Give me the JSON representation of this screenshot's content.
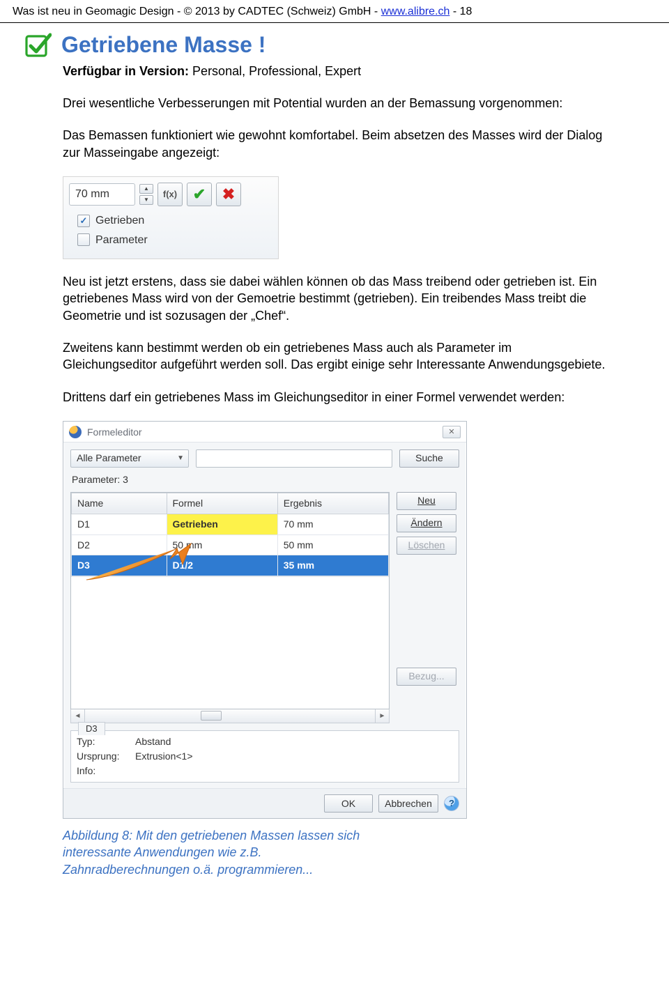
{
  "header": {
    "part1": "Was ist neu in Geomagic Design  -  © 2013 by CADTEC (Schweiz) GmbH  -  ",
    "link": "www.alibre.ch",
    "part2": "  -   18"
  },
  "title": "Getriebene Masse !",
  "avail_label": "Verfügbar in Version:",
  "avail_value": " Personal, Professional, Expert",
  "p_intro": "Drei wesentliche Verbesserungen mit Potential wurden an der Bemassung vorgenommen:",
  "p_first": "Das Bemassen funktioniert wie gewohnt komfortabel. Beim absetzen des Masses wird der Dialog zur Masseingabe angezeigt:",
  "dialog1": {
    "value": "70 mm",
    "fx": "f(x)",
    "cb1_checked": true,
    "cb1_label": "Getrieben",
    "cb2_checked": false,
    "cb2_label": "Parameter"
  },
  "p_neu": "Neu ist jetzt erstens, dass sie dabei wählen können ob das Mass treibend oder getrieben ist. Ein getriebenes Mass wird von der Gemoetrie bestimmt (getrieben). Ein treibendes Mass treibt die Geometrie und ist sozusagen der „Chef“.",
  "p_zwei": "Zweitens kann bestimmt werden ob ein getriebenes Mass auch als Parameter im Gleichungseditor aufgeführt werden soll. Das ergibt einige sehr Interessante Anwendungsgebiete.",
  "p_drei": "Drittens darf ein getriebenes Mass im Gleichungseditor in einer Formel verwendet werden:",
  "dialog2": {
    "title": "Formeleditor",
    "filter": "Alle Parameter",
    "search_btn": "Suche",
    "param_label": "Parameter:  3",
    "headers": {
      "name": "Name",
      "formel": "Formel",
      "ergebnis": "Ergebnis"
    },
    "rows": [
      {
        "name": "D1",
        "formel": "Getrieben",
        "ergebnis": "70 mm",
        "hl": true
      },
      {
        "name": "D2",
        "formel": "50 mm",
        "ergebnis": "50 mm"
      },
      {
        "name": "D3",
        "formel": "D1/2",
        "ergebnis": "35 mm",
        "sel": true
      }
    ],
    "btn_neu": "Neu",
    "btn_aendern": "Ändern",
    "btn_loeschen": "Löschen",
    "btn_bezug": "Bezug...",
    "info_tab": "D3",
    "info_typ_k": "Typ:",
    "info_typ_v": "Abstand",
    "info_urs_k": "Ursprung:",
    "info_urs_v": "Extrusion<1>",
    "info_info_k": "Info:",
    "ok": "OK",
    "cancel": "Abbrechen"
  },
  "caption_line1": "Abbildung 8: Mit den getriebenen Massen lassen sich",
  "caption_line2": "interessante Anwendungen wie z.B.",
  "caption_line3": "Zahnradberechnungen o.ä. programmieren..."
}
